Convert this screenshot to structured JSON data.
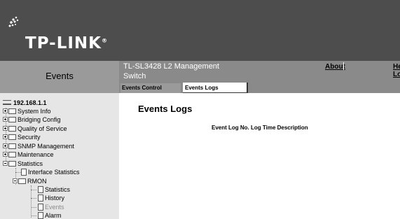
{
  "header": {
    "logo_text": "TP-LINK",
    "logo_reg": "®"
  },
  "left_title": "Events",
  "top_bar": {
    "system_title": "TL-SL3428 L2 Management Switch",
    "about": "About",
    "help": "Hel",
    "logout": "Logo"
  },
  "tabs": [
    {
      "label": "Events Control",
      "active": false
    },
    {
      "label": "Events Logs",
      "active": true
    }
  ],
  "tree": {
    "root": "192.168.1.1",
    "items": [
      {
        "label": "System Info"
      },
      {
        "label": "Bridging Config"
      },
      {
        "label": "Quality of Service"
      },
      {
        "label": "Security"
      },
      {
        "label": "SNMP Management"
      },
      {
        "label": "Maintenance"
      },
      {
        "label": "Statistics"
      },
      {
        "label": "Interface Statistics"
      },
      {
        "label": "RMON"
      },
      {
        "label": "Statistics"
      },
      {
        "label": "History"
      },
      {
        "label": "Events"
      },
      {
        "label": "Alarm"
      }
    ]
  },
  "main": {
    "title": "Events Logs",
    "table_header": "Event Log No. Log Time Description"
  },
  "colors": {
    "header_bg": "#4d4d4d",
    "bar_bg": "#8a8a8a",
    "sidebar_bg": "#e6e6e6",
    "selected_item": "#8c8c8c"
  }
}
